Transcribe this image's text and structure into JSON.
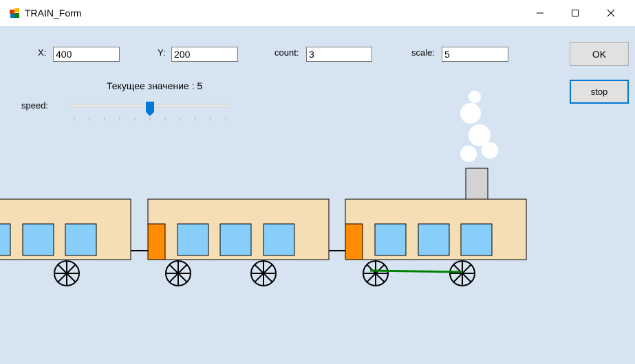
{
  "window": {
    "title": "TRAIN_Form"
  },
  "form": {
    "x_label": "X:",
    "x_value": "400",
    "y_label": "Y:",
    "y_value": "200",
    "count_label": "count:",
    "count_value": "3",
    "scale_label": "scale:",
    "scale_value": "5",
    "current_value_text": "Текущее значение : 5",
    "speed_label": "speed:",
    "speed_value": 5,
    "speed_min": 0,
    "speed_max": 10
  },
  "buttons": {
    "ok_label": "OK",
    "stop_label": "stop"
  },
  "colors": {
    "background": "#d6e4f1",
    "car_body": "#f5deb3",
    "window": "#87cefa",
    "door": "#ff8c00",
    "chimney": "#d3d3d3",
    "smoke": "#ffffff",
    "coupling_rod": "#008000",
    "slider_thumb": "#0078d7"
  },
  "icons": {
    "app": "form-app-icon",
    "minimize": "minimize-icon",
    "maximize": "maximize-icon",
    "close": "close-icon"
  }
}
